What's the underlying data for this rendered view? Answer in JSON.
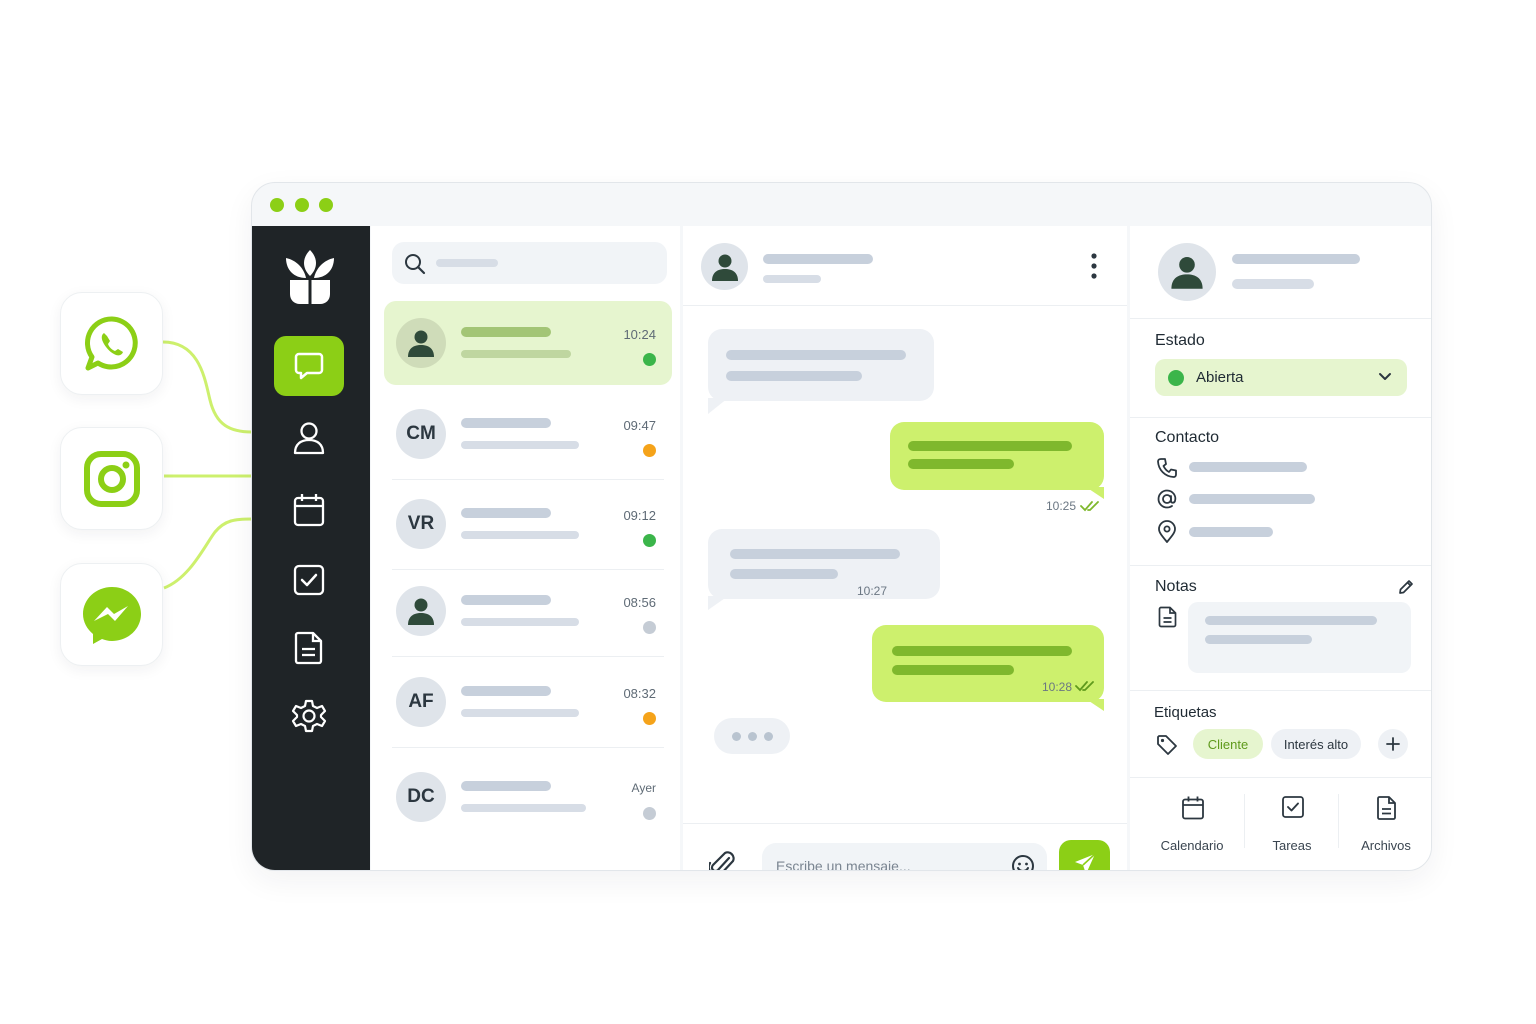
{
  "channels": [
    {
      "name": "whatsapp-icon"
    },
    {
      "name": "instagram-icon"
    },
    {
      "name": "messenger-icon"
    }
  ],
  "colors": {
    "accent": "#8ccf16",
    "online": "#3bb54a",
    "away": "#f5a31a",
    "offline": "#c5ccd5",
    "sidebar": "#1f2427"
  },
  "sidebar": {
    "logo": "sprout-logo",
    "items": [
      {
        "icon": "chat-icon",
        "active": true
      },
      {
        "icon": "user-icon"
      },
      {
        "icon": "calendar-icon"
      },
      {
        "icon": "checkbox-icon"
      },
      {
        "icon": "document-icon"
      },
      {
        "icon": "gear-icon"
      }
    ]
  },
  "conversations": [
    {
      "initials": "",
      "time": "10:24",
      "status": "online",
      "active": true
    },
    {
      "initials": "CM",
      "time": "09:47",
      "status": "away"
    },
    {
      "initials": "VR",
      "time": "09:12",
      "status": "online"
    },
    {
      "initials": "",
      "time": "08:56",
      "status": "offline"
    },
    {
      "initials": "AF",
      "time": "08:32",
      "status": "away"
    },
    {
      "initials": "DC",
      "time": "Ayer",
      "status": "offline"
    }
  ],
  "chat": {
    "messages": [
      {
        "direction": "in",
        "time": ""
      },
      {
        "direction": "out",
        "time": "10:25"
      },
      {
        "direction": "in",
        "time": "10:27"
      },
      {
        "direction": "out",
        "time": "10:28"
      }
    ],
    "composer_placeholder": "Escribe un mensaje..."
  },
  "details": {
    "estado_title": "Estado",
    "estado_value": "Abierta",
    "contacto_title": "Contacto",
    "notas_title": "Notas",
    "etiquetas_title": "Etiquetas",
    "tags": [
      "Cliente",
      "Interés alto"
    ],
    "bottom": [
      {
        "label": "Calendario",
        "icon": "calendar-icon"
      },
      {
        "label": "Tareas",
        "icon": "checkbox-icon"
      },
      {
        "label": "Archivos",
        "icon": "document-icon"
      }
    ]
  }
}
